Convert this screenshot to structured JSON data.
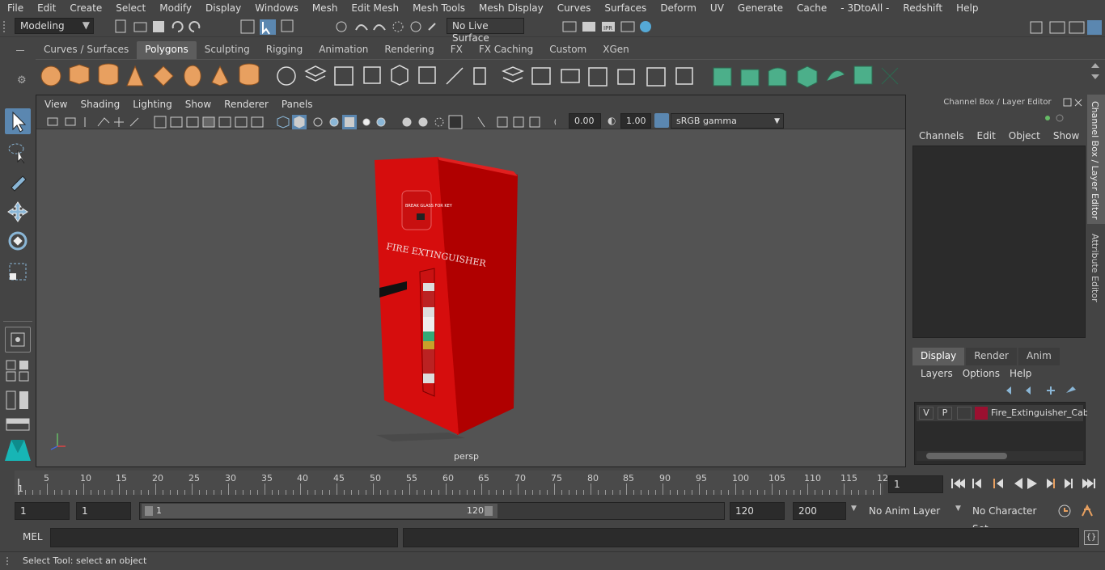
{
  "menu": [
    "File",
    "Edit",
    "Create",
    "Select",
    "Modify",
    "Display",
    "Windows",
    "Mesh",
    "Edit Mesh",
    "Mesh Tools",
    "Mesh Display",
    "Curves",
    "Surfaces",
    "Deform",
    "UV",
    "Generate",
    "Cache",
    "- 3DtoAll -",
    "Redshift",
    "Help"
  ],
  "status": {
    "workspace": "Modeling",
    "live_surface": "No Live Surface"
  },
  "shelf_tabs": [
    "Curves / Surfaces",
    "Polygons",
    "Sculpting",
    "Rigging",
    "Animation",
    "Rendering",
    "FX",
    "FX Caching",
    "Custom",
    "XGen"
  ],
  "shelf_active": "Polygons",
  "viewport": {
    "menu": [
      "View",
      "Shading",
      "Lighting",
      "Show",
      "Renderer",
      "Panels"
    ],
    "exposure": "0.00",
    "gamma": "1.00",
    "color_space": "sRGB gamma",
    "camera": "persp",
    "object_label": "FIRE EXTINGUISHER",
    "sign_text": "BREAK GLASS FOR KEY"
  },
  "channel_box": {
    "title": "Channel Box / Layer Editor",
    "menu": [
      "Channels",
      "Edit",
      "Object",
      "Show"
    ],
    "tabs": [
      "Display",
      "Render",
      "Anim"
    ],
    "active_tab": "Display",
    "layer_menu": [
      "Layers",
      "Options",
      "Help"
    ],
    "layer": {
      "v": "V",
      "p": "P",
      "name": "Fire_Extinguisher_Cab",
      "color": "#9b1030"
    }
  },
  "side_tabs": [
    "Channel Box / Layer Editor",
    "Attribute Editor"
  ],
  "timeline": {
    "ticks": [
      "5",
      "10",
      "15",
      "20",
      "25",
      "30",
      "35",
      "40",
      "45",
      "50",
      "55",
      "60",
      "65",
      "70",
      "75",
      "80",
      "85",
      "90",
      "95",
      "100",
      "105",
      "110",
      "115",
      "12"
    ],
    "start_marker": "1",
    "current_frame": "1"
  },
  "range": {
    "start": "1",
    "start2": "1",
    "slider_start": "1",
    "slider_end": "120",
    "end": "120",
    "end2": "200",
    "anim_layer": "No Anim Layer",
    "char_set": "No Character Set"
  },
  "mel": {
    "label": "MEL"
  },
  "statusbar": {
    "text": "Select Tool: select an object"
  }
}
